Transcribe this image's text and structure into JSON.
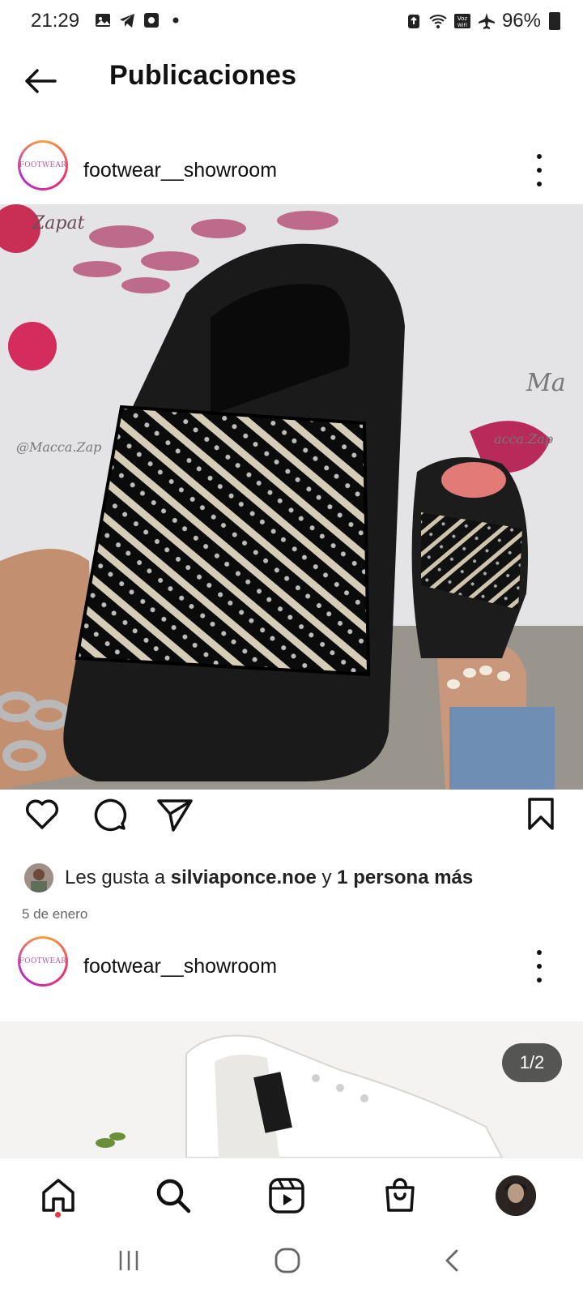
{
  "status_bar": {
    "time": "21:29",
    "battery": "96%",
    "left_icons": [
      "gallery-icon",
      "telegram-icon",
      "media-icon",
      "dot-icon"
    ],
    "right_icons": [
      "recycle-icon",
      "wifi-icon",
      "voz-wifi-icon",
      "airplane-icon",
      "battery-icon"
    ]
  },
  "header": {
    "title": "Publicaciones",
    "back_icon": "arrow-left-icon"
  },
  "posts": [
    {
      "username": "footwear__showroom",
      "avatar_text": "FOOTWEAR",
      "likes_prefix": "Les gusta a ",
      "liker": "silviaponce.noe",
      "likes_connector": " y ",
      "likes_others": "1 persona más",
      "date": "5 de enero"
    },
    {
      "username": "footwear__showroom",
      "avatar_text": "FOOTWEAR",
      "counter": "1/2"
    }
  ],
  "bottom_nav": [
    "home-icon",
    "search-icon",
    "reels-icon",
    "shop-icon",
    "profile-avatar"
  ],
  "colors": {
    "accent_dot": "#e8334a",
    "ring_start": "#f9a13a",
    "ring_mid": "#e8336e",
    "ring_end": "#b62fc4"
  }
}
